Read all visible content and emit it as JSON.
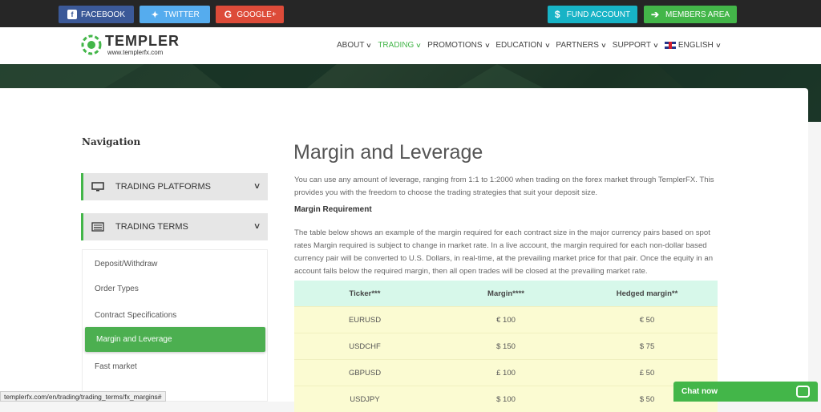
{
  "topbar": {
    "facebook": "FACEBOOK",
    "twitter": "TWITTER",
    "googleplus": "GOOGLE+",
    "fund_account": "FUND ACCOUNT",
    "members_area": "MEMBERS AREA"
  },
  "header": {
    "logo_name": "TEMPLER",
    "logo_url": "www.templerfx.com",
    "nav": [
      "ABOUT",
      "TRADING",
      "PROMOTIONS",
      "EDUCATION",
      "PARTNERS",
      "SUPPORT",
      "ENGLISH"
    ],
    "active_nav": "TRADING"
  },
  "sidebar": {
    "title": "Navigation",
    "accordion": [
      "TRADING PLATFORMS",
      "TRADING TERMS"
    ],
    "items": [
      "Deposit/Withdraw",
      "Order Types",
      "Contract Specifications",
      "Margin and Leverage",
      "Fast market"
    ],
    "active_item": "Margin and Leverage"
  },
  "main": {
    "title": "Margin and Leverage",
    "intro": "You can use any amount of leverage, ranging from 1:1 to 1:2000 when trading on the forex market through TemplerFX. This provides you with the freedom to choose the trading strategies that suit your deposit size.",
    "subheading": "Margin Requirement",
    "body": "The table below shows an example of the margin required for each contract size in the major currency pairs based on spot rates Margin required is subject to change in market rate. In a live account, the margin required for each non-dollar based currency pair will be converted to U.S. Dollars, in real-time, at the prevailing market price for that pair. Once the equity in an account falls below the required margin, then all open trades will be closed at the prevailing market rate.",
    "table": {
      "headers": [
        "Ticker***",
        "Margin****",
        "Hedged margin**"
      ],
      "rows": [
        [
          "EURUSD",
          "€ 100",
          "€ 50"
        ],
        [
          "USDCHF",
          "$ 150",
          "$ 75"
        ],
        [
          "GBPUSD",
          "£ 100",
          "£ 50"
        ],
        [
          "USDJPY",
          "$ 100",
          "$ 50"
        ]
      ]
    }
  },
  "status_url": "templerfx.com/en/trading/trading_terms/fx_margins#",
  "chat": {
    "label": "Chat now"
  },
  "colors": {
    "accent_green": "#43b649",
    "fund_cyan": "#17b3c6",
    "facebook": "#3b5998",
    "twitter": "#55acee",
    "google": "#dd4b39"
  }
}
